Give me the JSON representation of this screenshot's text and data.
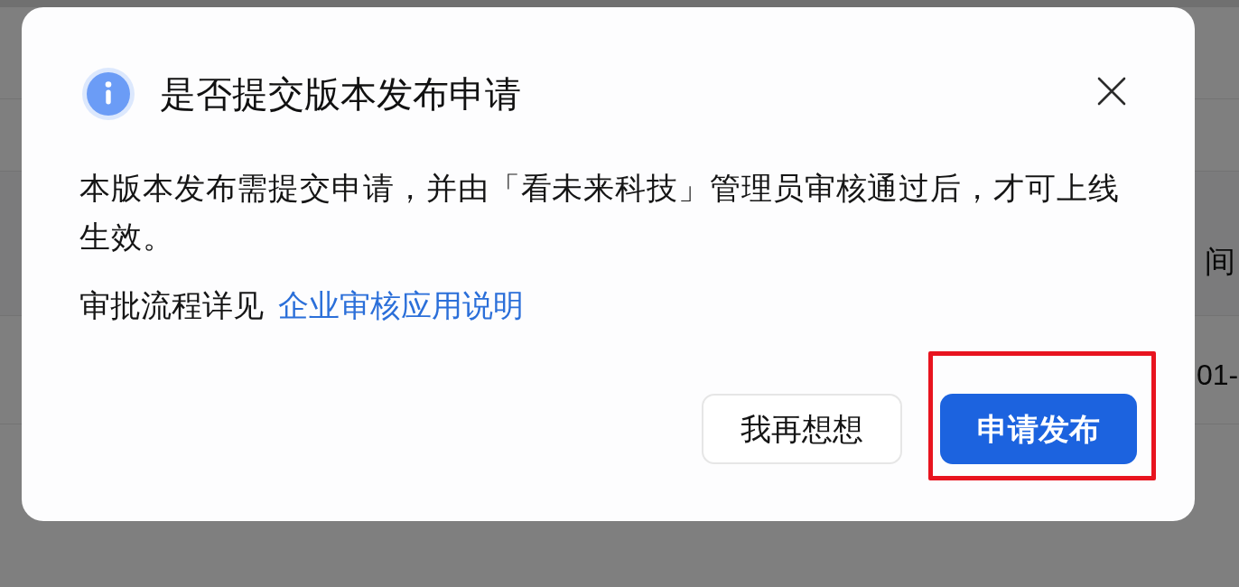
{
  "background_table": {
    "column_header": "间",
    "cell": "01-"
  },
  "dialog": {
    "title": "是否提交版本发布申请",
    "message": "本版本发布需提交申请，并由「看未来科技」管理员审核通过后，才可上线生效。",
    "note": {
      "text": "审批流程详见",
      "link": "企业审核应用说明"
    },
    "buttons": [
      {
        "label": "我再想想",
        "kind": "secondary",
        "highlighted": false
      },
      {
        "label": "申请发布",
        "kind": "primary",
        "highlighted": true
      }
    ]
  }
}
